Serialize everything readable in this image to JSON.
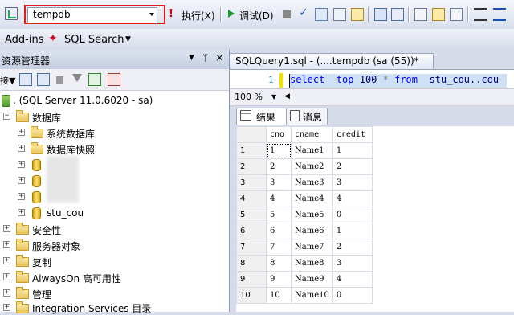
{
  "toolbar1": {
    "database_selector": {
      "value": "tempdb"
    },
    "execute_label": "执行(X)",
    "debug_label": "调试(D)"
  },
  "toolbar2": {
    "addins_label": "Add-ins",
    "sql_search_label": "SQL Search"
  },
  "object_explorer": {
    "title": "资源管理器",
    "connect_label": "接▼",
    "server_node": ". (SQL Server 11.0.6020 - sa)",
    "databases_label": "数据库",
    "system_databases_label": "系统数据库",
    "snapshots_label": "数据库快照",
    "stu_cou_label": "stu_cou",
    "security_label": "安全性",
    "server_objects_label": "服务器对象",
    "replication_label": "复制",
    "alwayson_label": "AlwaysOn 高可用性",
    "management_label": "管理",
    "integration_label": "Integration Services 目录"
  },
  "editor": {
    "tab_title": "SQLQuery1.sql - (....tempdb (sa (55))*",
    "line_number": "1",
    "sql_text": "select  top 100 * from  stu_cou..cou",
    "zoom": "100 %"
  },
  "results": {
    "tab_results": "结果",
    "tab_messages": "消息",
    "columns": [
      "cno",
      "cname",
      "credit"
    ],
    "rows": [
      [
        "1",
        "1",
        "Name1",
        "1"
      ],
      [
        "2",
        "2",
        "Name2",
        "2"
      ],
      [
        "3",
        "3",
        "Name3",
        "3"
      ],
      [
        "4",
        "4",
        "Name4",
        "4"
      ],
      [
        "5",
        "5",
        "Name5",
        "0"
      ],
      [
        "6",
        "6",
        "Name6",
        "1"
      ],
      [
        "7",
        "7",
        "Name7",
        "2"
      ],
      [
        "8",
        "8",
        "Name8",
        "3"
      ],
      [
        "9",
        "9",
        "Name9",
        "4"
      ],
      [
        "10",
        "10",
        "Name10",
        "0"
      ]
    ]
  },
  "colors": {
    "highlight_border": "#d9201a",
    "sql_keyword": "#0000ff"
  }
}
